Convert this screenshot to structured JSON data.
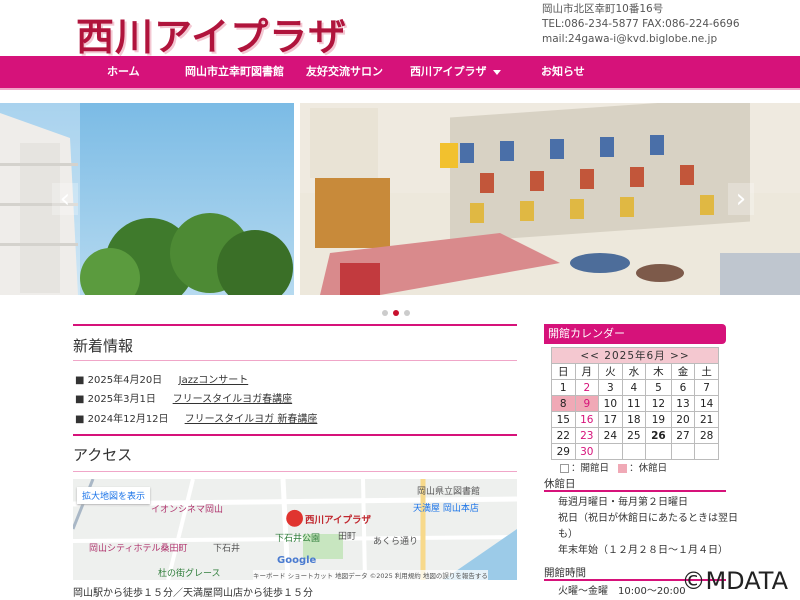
{
  "header": {
    "logo": "西川アイプラザ",
    "address": "岡山市北区幸町10番16号",
    "tel": "TEL:086-234-5877 FAX:086-224-6696",
    "mail": "mail:24gawa-i@kvd.biglobe.ne.jp"
  },
  "nav": [
    "ホーム",
    "岡山市立幸町図書館",
    "友好交流サロン",
    "西川アイプラザ",
    "お知らせ"
  ],
  "colors": {
    "accent": "#d6127a",
    "logo": "#b0143c",
    "closed": "#f0a9b6"
  },
  "news": {
    "title": "新着情報",
    "items": [
      {
        "date": "2025年4月20日",
        "label": "Jazzコンサート"
      },
      {
        "date": "2025年3月1日",
        "label": "フリースタイルヨガ春講座"
      },
      {
        "date": "2024年12月12日",
        "label": "フリースタイルヨガ 新春講座"
      }
    ]
  },
  "access": {
    "title": "アクセス",
    "map_link": "拡大地図を表示",
    "note": "岡山駅から徒歩１５分／天満屋岡山店から徒歩１５分",
    "map_labels": {
      "pin": "西川アイプラザ",
      "cinema": "イオンシネマ岡山",
      "hotel": "岡山シティホテル桑田町",
      "park": "下石井公園",
      "library": "岡山県立図書館",
      "dept": "天満屋 岡山本店",
      "street1": "あくら通り",
      "town1": "下石井",
      "town2": "田町",
      "grace": "杜の街グレース",
      "google": "Google",
      "credit": "キーボード ショートカット  地図データ ©2025  利用規約  地図の誤りを報告する"
    }
  },
  "calendar": {
    "title": "開館カレンダー",
    "month": "<<  2025年6月  >>",
    "weekdays": [
      "日",
      "月",
      "火",
      "水",
      "木",
      "金",
      "土"
    ],
    "rows": [
      [
        "1",
        "2",
        "3",
        "4",
        "5",
        "6",
        "7"
      ],
      [
        "8",
        "9",
        "10",
        "11",
        "12",
        "13",
        "14"
      ],
      [
        "15",
        "16",
        "17",
        "18",
        "19",
        "20",
        "21"
      ],
      [
        "22",
        "23",
        "24",
        "25",
        "26",
        "27",
        "28"
      ],
      [
        "29",
        "30",
        "",
        "",
        "",
        "",
        ""
      ]
    ],
    "closed_days": [
      "8",
      "9"
    ],
    "pink_text_days": [
      "2",
      "9",
      "16",
      "23",
      "30"
    ],
    "today": "26",
    "legend_open": "：開館日",
    "legend_closed": "：休館日"
  },
  "closed": {
    "title": "休館日",
    "lines": [
      "毎週月曜日・毎月第２日曜日",
      "祝日（祝日が休館日にあたるときは翌日",
      "も）",
      "年末年始（１２月２８日～１月４日）"
    ]
  },
  "hours": {
    "title": "開館時間",
    "line": "火曜～金曜　10:00～20:00"
  },
  "watermark": "©MDATA"
}
